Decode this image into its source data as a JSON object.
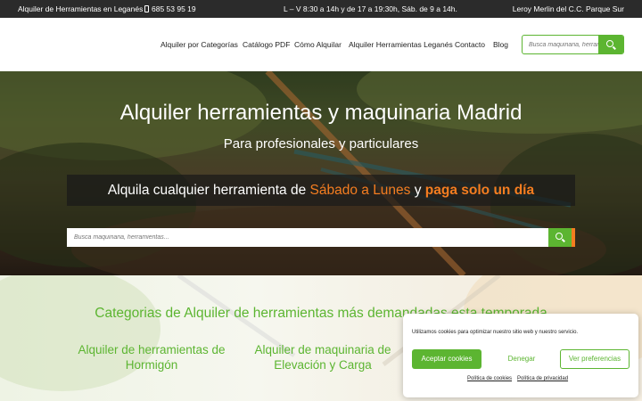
{
  "topbar": {
    "store_name": "Alquiler de Herramientas en Leganés",
    "phone": "685 53 95 19",
    "hours": "L – V 8:30 a 14h y de 17 a 19:30h, Sáb. de 9 a 14h.",
    "location": "Leroy Merlin del C.C. Parque Sur"
  },
  "nav": {
    "items": [
      "Alquiler por Categorías",
      "Catálogo PDF",
      "Cómo Alquilar",
      "Alquiler Herramientas Leganés",
      "Contacto",
      "Blog"
    ],
    "search_placeholder": "Busca maquinaria, herramientas..."
  },
  "hero": {
    "title": "Alquiler herramientas y maquinaria Madrid",
    "subtitle": "Para profesionales y particulares",
    "promo_prefix": "Alquila cualquier herramienta de ",
    "promo_highlight1": "Sábado a Lunes",
    "promo_mid": " y ",
    "promo_highlight2": "paga solo un día",
    "search_placeholder": "Busca maquinaria, herramientas..."
  },
  "categories": {
    "heading": "Categorias de Alquiler de herramientas más demandadas esta temporada",
    "items": [
      {
        "line1": "Alquiler de herramientas de",
        "line2": "Hormigón"
      },
      {
        "line1": "Alquiler de maquinaria de",
        "line2": "Elevación y Carga"
      }
    ]
  },
  "cookie": {
    "message": "Utilizamos cookies para optimizar nuestro sitio web y nuestro servicio.",
    "accept": "Aceptar cookies",
    "deny": "Denegar",
    "preferences": "Ver preferencias",
    "cookie_policy": "Política de cookies",
    "privacy_policy": "Política de privacidad"
  },
  "colors": {
    "brand_green": "#5cb531",
    "accent_orange": "#f47d20",
    "topbar_bg": "#2b2b2b"
  },
  "icons": {
    "phone": "phone-icon",
    "search": "search-icon"
  }
}
